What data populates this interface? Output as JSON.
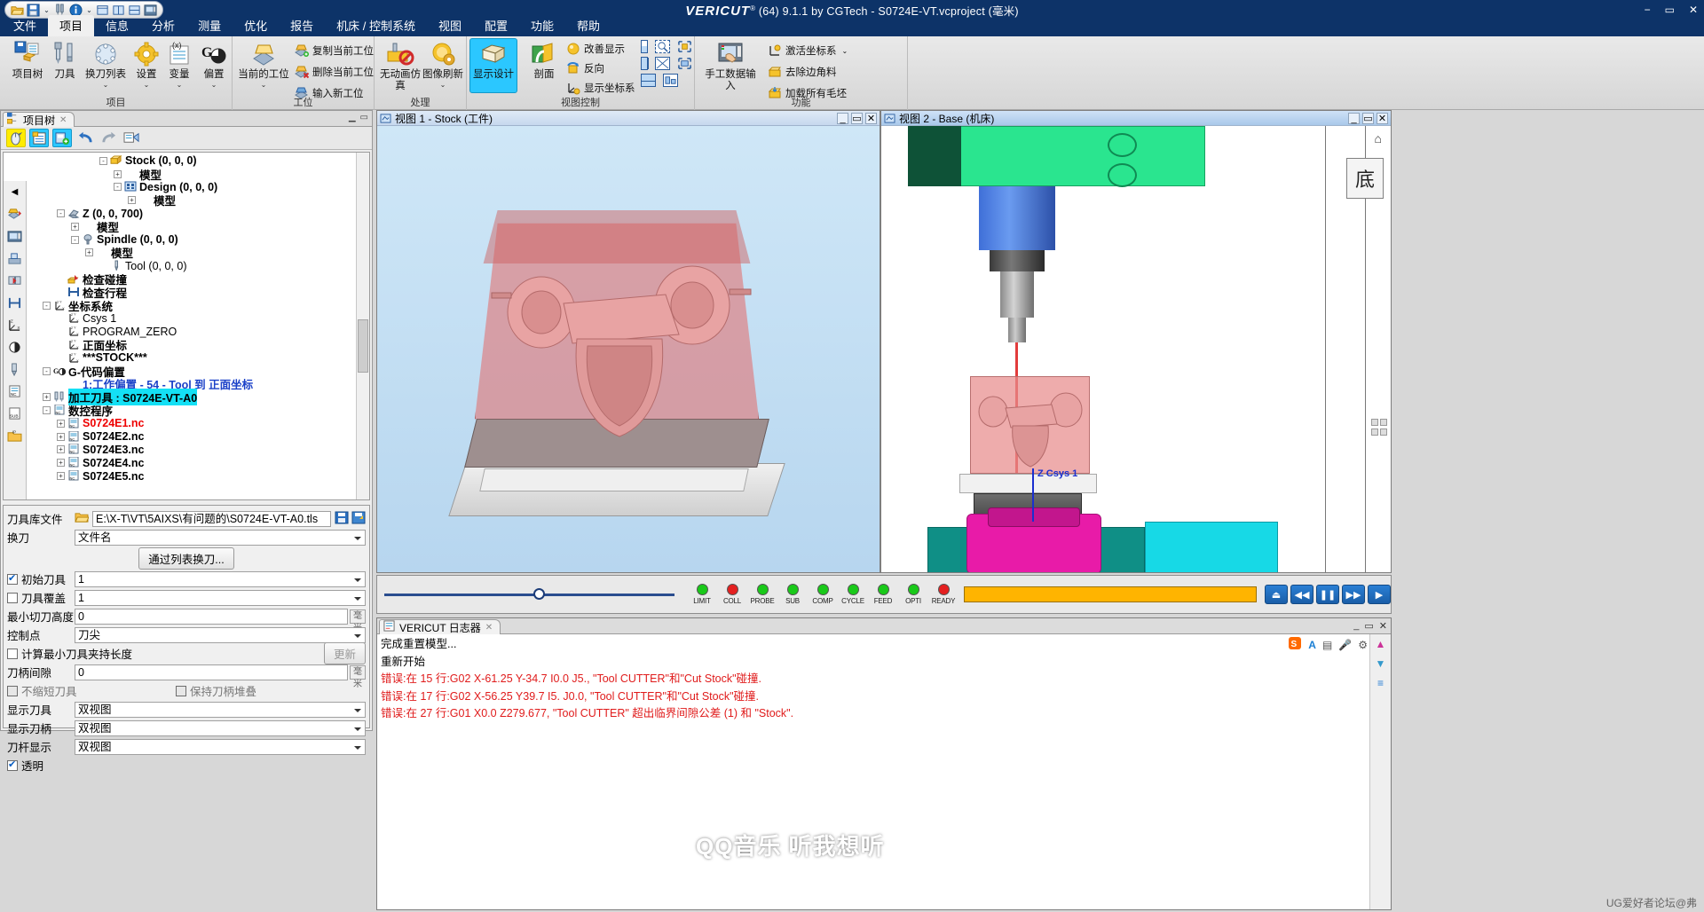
{
  "titlebar": {
    "logo": "VERICUT",
    "reg": "®",
    "text": "(64)  9.1.1 by CGTech - S0724E-VT.vcproject (毫米)",
    "min": "−",
    "max": "▭",
    "close": "✕"
  },
  "qat": {
    "open": "open-folder-icon",
    "save": "save-icon",
    "save_caret": "⌄",
    "tool": "tool-icon",
    "info": "info-icon",
    "info_caret": "⌄",
    "layout1": "single-pane-icon",
    "layout2": "two-pane-icon",
    "layout3": "stacked-pane-icon",
    "machine": "machine-icon"
  },
  "menu": {
    "items": [
      {
        "label": "文件",
        "active": false
      },
      {
        "label": "项目",
        "active": true
      },
      {
        "label": "信息",
        "active": false
      },
      {
        "label": "分析",
        "active": false
      },
      {
        "label": "测量",
        "active": false
      },
      {
        "label": "优化",
        "active": false
      },
      {
        "label": "报告",
        "active": false
      },
      {
        "label": "机床 / 控制系统",
        "active": false
      },
      {
        "label": "视图",
        "active": false
      },
      {
        "label": "配置",
        "active": false
      },
      {
        "label": "功能",
        "active": false
      },
      {
        "label": "帮助",
        "active": false
      }
    ]
  },
  "ribbon": {
    "groups": [
      {
        "title": "项目"
      },
      {
        "title": "工位"
      },
      {
        "title": "处理"
      },
      {
        "title": "视图控制"
      },
      {
        "title": "功能"
      }
    ],
    "project": [
      {
        "label": "项目树",
        "dd": ""
      },
      {
        "label": "刀具",
        "dd": ""
      },
      {
        "label": "换刀列表",
        "dd": "⌄"
      },
      {
        "label": "设置",
        "dd": "⌄"
      },
      {
        "label": "变量",
        "dd": "⌄"
      },
      {
        "label": "偏置",
        "dd": "⌄"
      }
    ],
    "station_big": {
      "label": "当前的工位",
      "dd": "⌄"
    },
    "station_small": [
      {
        "label": "复制当前工位"
      },
      {
        "label": "删除当前工位"
      },
      {
        "label": "输入新工位"
      }
    ],
    "process": [
      {
        "label": "无动画仿真",
        "dd": ""
      },
      {
        "label": "图像刷新",
        "dd": "⌄"
      }
    ],
    "viewctrl_big": [
      {
        "label": "显示设计",
        "selected": true
      },
      {
        "label": "剖面",
        "selected": false
      }
    ],
    "viewctrl_small": [
      {
        "label": "改善显示"
      },
      {
        "label": "反向"
      },
      {
        "label": "显示坐标系"
      }
    ],
    "function": [
      {
        "label": "手工数据输入"
      },
      {
        "label": "激活坐标系",
        "dd": "⌄"
      },
      {
        "label": "去除边角料"
      },
      {
        "label": "加载所有毛坯"
      }
    ]
  },
  "leftpanel": {
    "tab": {
      "label": "项目树",
      "icon": "project-tree-icon",
      "close": "✕"
    },
    "toolbar": [
      {
        "name": "mouse-select-icon"
      },
      {
        "name": "config-list-icon"
      },
      {
        "name": "add-component-icon"
      },
      {
        "name": "undo-icon"
      },
      {
        "name": "redo-icon"
      },
      {
        "name": "export-icon"
      }
    ],
    "tree": [
      {
        "indent": 5,
        "exp": "-",
        "icon": "stock-icon",
        "label": "Stock (0, 0, 0)",
        "style": "b"
      },
      {
        "indent": 6,
        "exp": "+",
        "icon": "model-icon",
        "label": "模型",
        "style": "b"
      },
      {
        "indent": 6,
        "exp": "-",
        "icon": "design-icon",
        "label": "Design (0, 0, 0)",
        "style": "b"
      },
      {
        "indent": 7,
        "exp": "+",
        "icon": "model-icon",
        "label": "模型",
        "style": "b"
      },
      {
        "indent": 2,
        "exp": "-",
        "icon": "axis-icon",
        "label": "Z (0, 0, 700)",
        "style": "b"
      },
      {
        "indent": 3,
        "exp": "+",
        "icon": "model-icon",
        "label": "模型",
        "style": "b"
      },
      {
        "indent": 3,
        "exp": "-",
        "icon": "spindle-icon",
        "label": "Spindle (0, 0, 0)",
        "style": "b"
      },
      {
        "indent": 4,
        "exp": "+",
        "icon": "model-icon",
        "label": "模型",
        "style": "b"
      },
      {
        "indent": 5,
        "exp": "",
        "icon": "tool-icon",
        "label": "Tool (0, 0, 0)",
        "style": ""
      },
      {
        "indent": 2,
        "exp": "",
        "icon": "collision-icon",
        "label": "检查碰撞",
        "style": "b"
      },
      {
        "indent": 2,
        "exp": "",
        "icon": "travel-icon",
        "label": "检查行程",
        "style": "b"
      },
      {
        "indent": 1,
        "exp": "-",
        "icon": "csys-icon",
        "label": "坐标系统",
        "style": "b"
      },
      {
        "indent": 2,
        "exp": "",
        "icon": "csys-icon",
        "label": "Csys 1",
        "style": ""
      },
      {
        "indent": 2,
        "exp": "",
        "icon": "csys-icon",
        "label": "PROGRAM_ZERO",
        "style": ""
      },
      {
        "indent": 2,
        "exp": "",
        "icon": "csys-icon",
        "label": "正面坐标",
        "style": "b"
      },
      {
        "indent": 2,
        "exp": "",
        "icon": "csys-icon",
        "label": "***STOCK***",
        "style": "b"
      },
      {
        "indent": 1,
        "exp": "-",
        "icon": "gcode-offset-icon",
        "label": "G-代码偏置",
        "style": "b"
      },
      {
        "indent": 2,
        "exp": "",
        "icon": "",
        "label": "1:工作偏置 - 54 - Tool 到 正面坐标",
        "style": "blue"
      },
      {
        "indent": 1,
        "exp": "+",
        "icon": "machining-tool-icon",
        "label": "加工刀具 : S0724E-VT-A0",
        "style": "sel"
      },
      {
        "indent": 1,
        "exp": "-",
        "icon": "nc-program-icon",
        "label": "数控程序",
        "style": "b"
      },
      {
        "indent": 2,
        "exp": "+",
        "icon": "nc-file-icon",
        "label": "S0724E1.nc",
        "style": "red"
      },
      {
        "indent": 2,
        "exp": "+",
        "icon": "nc-file-icon",
        "label": "S0724E2.nc",
        "style": "b"
      },
      {
        "indent": 2,
        "exp": "+",
        "icon": "nc-file-icon",
        "label": "S0724E3.nc",
        "style": "b"
      },
      {
        "indent": 2,
        "exp": "+",
        "icon": "nc-file-icon",
        "label": "S0724E4.nc",
        "style": "b"
      },
      {
        "indent": 2,
        "exp": "+",
        "icon": "nc-file-icon",
        "label": "S0724E5.nc",
        "style": "b"
      }
    ],
    "sidetools": [
      "collapse-arrow-icon",
      "stock-setup-icon",
      "machine-icon",
      "fixture-icon",
      "collision-icon",
      "travel-icon",
      "csys-icon",
      "gcode-offset-icon",
      "tool-icon",
      "nc-program-icon",
      "sub-program-icon",
      "ip-folder-icon"
    ],
    "form": {
      "tool_library_label": "刀具库文件",
      "tool_library_value": "E:\\X-T\\VT\\5AIXS\\有问题的\\S0724E-VT-A0.tls",
      "toolchange_label": "换刀",
      "toolchange_value": "文件名",
      "toolchange_button": "通过列表换刀...",
      "initial_tool_label": "初始刀具",
      "initial_tool_checked": true,
      "initial_tool_value": "1",
      "tool_override_label": "刀具覆盖",
      "tool_override_checked": false,
      "tool_override_value": "1",
      "min_cut_height_label": "最小切刀高度",
      "min_cut_height_value": "0",
      "min_cut_height_unit": "毫米",
      "control_point_label": "控制点",
      "control_point_value": "刀尖",
      "calc_min_holder_label": "计算最小刀具夹持长度",
      "calc_min_holder_checked": false,
      "update_button": "更新",
      "shank_clearance_label": "刀柄间隙",
      "shank_clearance_value": "0",
      "shank_clearance_unit": "毫米",
      "no_scale_label": "不缩短刀具",
      "no_scale_checked": false,
      "keep_holder_stack_label": "保持刀柄堆叠",
      "keep_holder_stack_checked": false,
      "show_tool_label": "显示刀具",
      "show_tool_value": "双视图",
      "show_holder_label": "显示刀柄",
      "show_holder_value": "双视图",
      "tool_bar_label": "刀杆显示",
      "tool_bar_value": "双视图",
      "transparent_label": "透明",
      "transparent_checked": true,
      "save_icon": "save-icon",
      "saveas_icon": "save-as-icon",
      "folder_icon": "open-folder-icon"
    }
  },
  "view1": {
    "title": "视图 1 - Stock (工件)",
    "icon": "view-icon",
    "btn_min": "_",
    "btn_max": "▭",
    "btn_close": "✕"
  },
  "view2": {
    "title": "视图 2 - Base (机床)",
    "icon": "view-icon",
    "btn_min": "_",
    "btn_max": "▭",
    "btn_close": "✕",
    "navcube": "底",
    "csys_label": "Z Csys 1"
  },
  "controlbar": {
    "lamps": [
      {
        "label": "LIMIT",
        "color": "#19c919"
      },
      {
        "label": "COLL",
        "color": "#e42020"
      },
      {
        "label": "PROBE",
        "color": "#19c919"
      },
      {
        "label": "SUB",
        "color": "#19c919"
      },
      {
        "label": "COMP",
        "color": "#19c919"
      },
      {
        "label": "CYCLE",
        "color": "#19c919"
      },
      {
        "label": "FEED",
        "color": "#19c919"
      },
      {
        "label": "OPTI",
        "color": "#19c919"
      },
      {
        "label": "READY",
        "color": "#e42020"
      }
    ],
    "progress_color": "#ffb400",
    "progress_pct": 100,
    "buttons": [
      {
        "name": "reset-button",
        "glyph": "⏏"
      },
      {
        "name": "step-back-button",
        "glyph": "◀◀"
      },
      {
        "name": "pause-button",
        "glyph": "❚❚"
      },
      {
        "name": "step-forward-button",
        "glyph": "▶▶"
      },
      {
        "name": "play-button",
        "glyph": "▶"
      }
    ]
  },
  "logpanel": {
    "tab": {
      "label": "VERICUT 日志器",
      "icon": "log-icon",
      "close": "✕"
    },
    "win_min": "_",
    "win_max": "▭",
    "win_close": "✕",
    "lines": [
      {
        "text": "完成重置模型...",
        "err": false
      },
      {
        "text": "重新开始",
        "err": false
      },
      {
        "text": "错误:在 15 行:G02 X-61.25 Y-34.7 I0.0 J5., \"Tool CUTTER\"和\"Cut Stock\"碰撞.",
        "err": true
      },
      {
        "text": "错误:在 17 行:G02 X-56.25 Y39.7 I5. J0.0, \"Tool CUTTER\"和\"Cut Stock\"碰撞.",
        "err": true
      },
      {
        "text": "错误:在 27 行:G01 X0.0 Z279.677, \"Tool CUTTER\" 超出临界间隙公差 (1) 和 \"Stock\".",
        "err": true
      }
    ],
    "toolicons": [
      "sogou-ime-icon",
      "font-a-icon",
      "clear-icon",
      "mic-icon",
      "settings-icon"
    ],
    "right_icons": [
      "scroll-up-icon",
      "scroll-down-icon",
      "filter-icon"
    ]
  },
  "watermark": {
    "big": "QQ音乐 听我想听",
    "small": "UG爱好者论坛@弗"
  }
}
